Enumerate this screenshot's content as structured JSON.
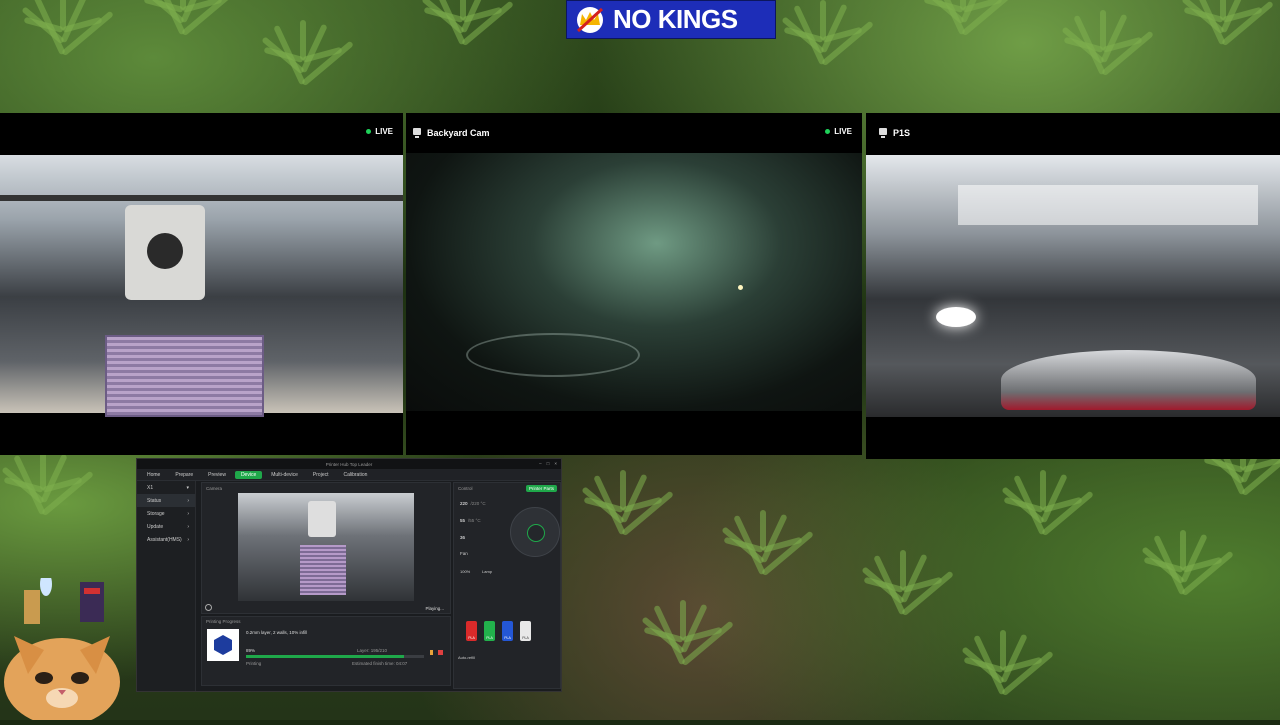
{
  "banner": {
    "text": "NO KINGS",
    "bg": "#1d2db8"
  },
  "cams": [
    {
      "title": "",
      "live": "LIVE"
    },
    {
      "title": "Backyard Cam",
      "live": "LIVE"
    },
    {
      "title": "P1S",
      "live": ""
    }
  ],
  "app": {
    "window_title": "Printer Hub Top Leader",
    "tabs": [
      "Home",
      "Prepare",
      "Preview",
      "Device",
      "Multi-device",
      "Project",
      "Calibration"
    ],
    "active_tab": "Device",
    "printer": "X1",
    "sidebar": [
      "Status",
      "Storage",
      "Update",
      "Assistant(HMS)"
    ],
    "camera_label": "Camera",
    "playing": "Playing...",
    "progress_title": "Printing Progress",
    "job_name": "0.2mm layer, 2 walls, 10% infill",
    "percent": "89%",
    "layer": "Layer: 195/210",
    "state": "Printing",
    "finish": "Estimated finish time: 04:07",
    "progress": 0.89,
    "control_label": "Control",
    "printer_parts": "Printer Parts",
    "nozzle_temp": "220",
    "nozzle_target": "/220 °C",
    "bed_temp": "55",
    "bed_target": "/55 °C",
    "chamber_temp": "36",
    "fan_label": "Fan",
    "fan_pct": "100%",
    "lamp_label": "Lamp",
    "ams_label": "Auto-refill",
    "spools": [
      {
        "label": "PLA",
        "color": "#d92a2a"
      },
      {
        "label": "PLA",
        "color": "#22b14c"
      },
      {
        "label": "PLA",
        "color": "#2457d6"
      },
      {
        "label": "PLA",
        "color": "#e8e8e8"
      }
    ]
  }
}
